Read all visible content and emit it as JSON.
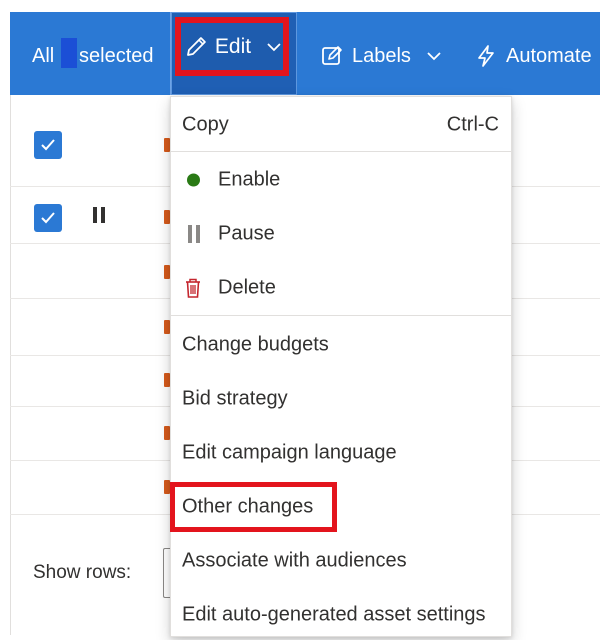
{
  "toolbar": {
    "all_label": "All",
    "selected_label": "selected",
    "edit_label": "Edit",
    "labels_label": "Labels",
    "automate_label": "Automate"
  },
  "menu": {
    "copy": "Copy",
    "copy_shortcut": "Ctrl-C",
    "enable": "Enable",
    "pause": "Pause",
    "delete": "Delete",
    "change_budgets": "Change budgets",
    "bid_strategy": "Bid strategy",
    "edit_campaign_language": "Edit campaign language",
    "other_changes": "Other changes",
    "associate_with_audiences": "Associate with audiences",
    "edit_auto_generated_asset_settings": "Edit auto-generated asset settings"
  },
  "footer": {
    "show_rows_label": "Show rows:"
  },
  "icons": {
    "edit": "pencil-icon",
    "labels": "label-edit-icon",
    "automate": "lightning-icon",
    "enable": "green-dot-icon",
    "pause": "pause-icon",
    "delete": "trash-icon"
  },
  "colors": {
    "toolbar_bg": "#2b79d4",
    "highlight": "#e3141d",
    "enable_dot": "#2a7a15",
    "delete_icon": "#c4262e"
  }
}
